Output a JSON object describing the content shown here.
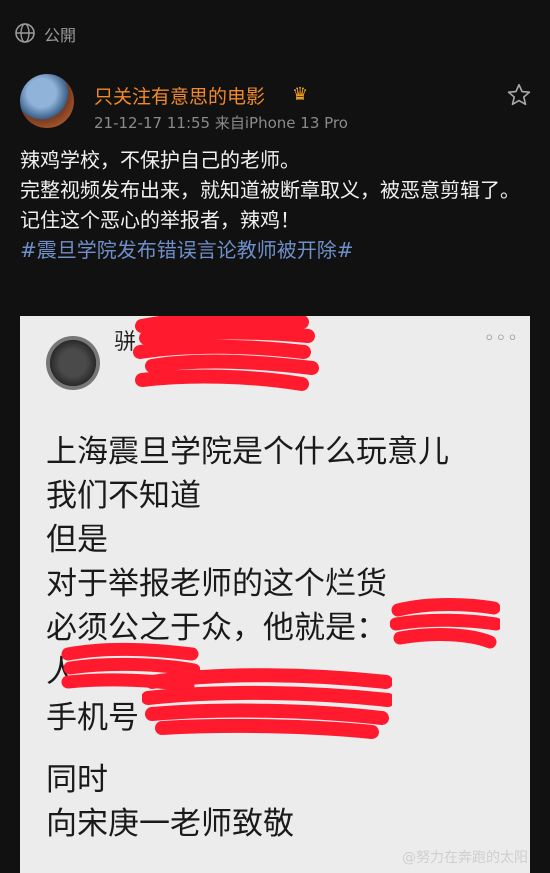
{
  "header": {
    "visibility_label": "公開",
    "visibility_icon": "globe-icon"
  },
  "post": {
    "author": "只关注有意思的电影",
    "author_badge_icon": "crown-icon",
    "timestamp": "21-12-17 11:55",
    "source": "来自iPhone 13 Pro",
    "favorite_icon": "star-icon",
    "lines": [
      "辣鸡学校，不保护自己的老师。",
      "完整视频发布出来，就知道被断章取义，被恶意剪辑了。",
      "记住这个恶心的举报者，辣鸡！"
    ],
    "hashtag": "#震旦学院发布错误言论教师被开除#"
  },
  "screenshot_card": {
    "name_fragment": "骈",
    "more_icon": "more-dots-icon",
    "lines": [
      "上海震旦学院是个什么玩意儿",
      "我们不知道",
      "但是",
      "对于举报老师的这个烂货",
      "必须公之于众，他就是：",
      "人",
      "手机号",
      "同时",
      "向宋庚一老师致敬"
    ]
  },
  "watermark": "@努力在奔跑的太阳",
  "colors": {
    "background": "#111111",
    "username": "#f08a2a",
    "hashtag": "#6f8fc9",
    "redaction": "#ff1a2e",
    "card": "#ececec"
  }
}
